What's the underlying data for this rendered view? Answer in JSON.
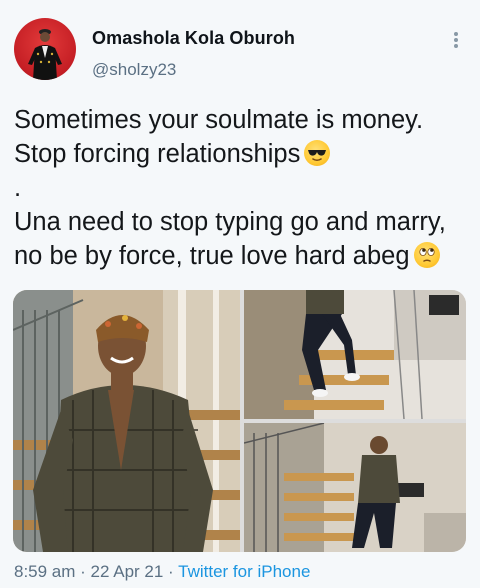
{
  "author": {
    "name": "Omashola Kola Oburoh",
    "handle": "@sholzy23"
  },
  "tweet": {
    "line1": "Sometimes your soulmate is money.",
    "line2": "Stop forcing relationships",
    "line3": ".",
    "line4": "Una need to stop typing go and marry,",
    "line5": "no be by force, true love hard abeg"
  },
  "icons": {
    "more": "more-vertical-icon",
    "emoji1": "sunglasses-emoji-icon",
    "emoji2": "eye-roll-emoji-icon"
  },
  "meta": {
    "time": "8:59 am",
    "separator1": " · ",
    "date": "22 Apr 21",
    "separator2": " · ",
    "source": "Twitter for iPhone"
  },
  "colors": {
    "secondary_text": "#5b7083",
    "link": "#1b95e0",
    "avatar_bg": "#c41e24"
  }
}
